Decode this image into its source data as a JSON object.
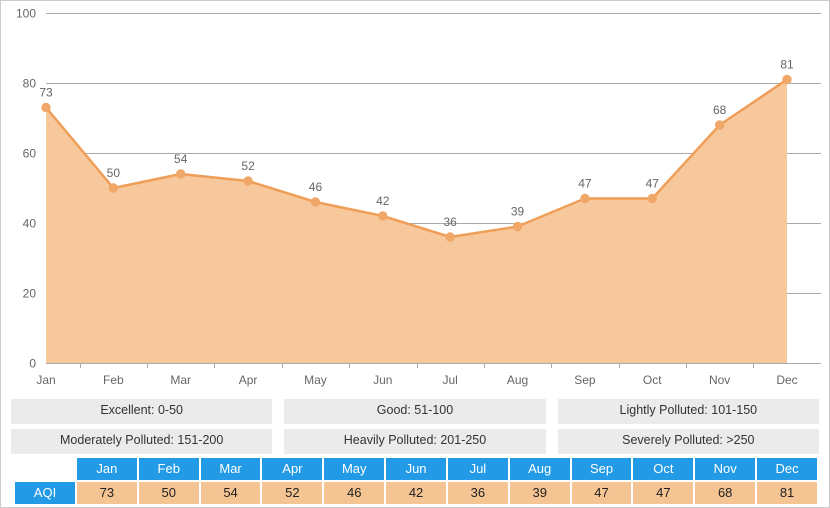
{
  "chart_data": {
    "type": "area",
    "title": "",
    "xlabel": "",
    "ylabel": "",
    "categories": [
      "Jan",
      "Feb",
      "Mar",
      "Apr",
      "May",
      "Jun",
      "Jul",
      "Aug",
      "Sep",
      "Oct",
      "Nov",
      "Dec"
    ],
    "values": [
      73,
      50,
      54,
      52,
      46,
      42,
      36,
      39,
      47,
      47,
      68,
      81
    ],
    "series": [
      {
        "name": "AQI",
        "values": [
          73,
          50,
          54,
          52,
          46,
          42,
          36,
          39,
          47,
          47,
          68,
          81
        ]
      }
    ],
    "ylim": [
      0,
      100
    ],
    "yticks": [
      0,
      20,
      40,
      60,
      80,
      100
    ],
    "ytick_labels": [
      "0",
      "20",
      "40",
      "60",
      "80",
      "100"
    ],
    "grid": true,
    "legend_position": "below-chart",
    "show_point_labels": true,
    "colors": {
      "area_fill": "#f7c89c",
      "line_stroke": "#ef9e58",
      "marker_fill": "#f0a768",
      "gridline": "#aaaaaa",
      "label_text": "#666666",
      "table_header": "#239ae6",
      "table_value": "#f5c493",
      "legend_background": "#ebebeb"
    }
  },
  "legend": {
    "rows": [
      [
        "Excellent: 0-50",
        "Good: 51-100",
        "Lightly Polluted: 101-150"
      ],
      [
        "Moderately Polluted: 151-200",
        "Heavily Polluted: 201-250",
        "Severely Polluted: >250"
      ]
    ]
  },
  "table": {
    "row_label": "AQI",
    "headers": [
      "Jan",
      "Feb",
      "Mar",
      "Apr",
      "May",
      "Jun",
      "Jul",
      "Aug",
      "Sep",
      "Oct",
      "Nov",
      "Dec"
    ],
    "values": [
      "73",
      "50",
      "54",
      "52",
      "46",
      "42",
      "36",
      "39",
      "47",
      "47",
      "68",
      "81"
    ]
  }
}
